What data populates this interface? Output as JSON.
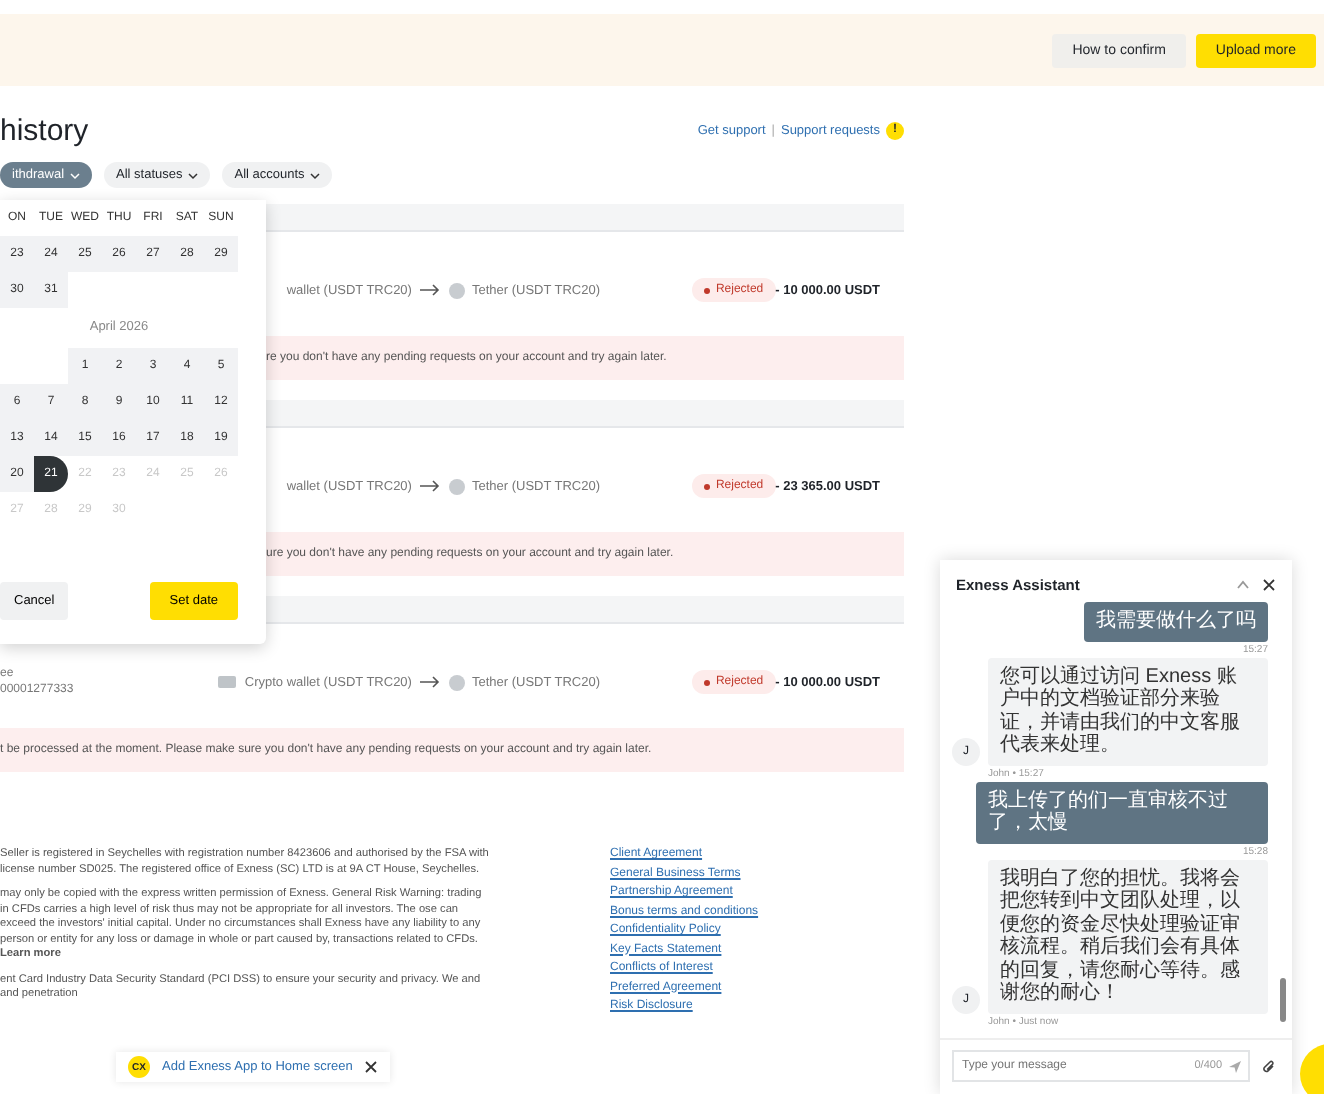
{
  "banner": {
    "buttons": [
      {
        "label": "How to confirm",
        "kind": "secondary"
      },
      {
        "label": "Upload more",
        "kind": "primary"
      }
    ]
  },
  "page": {
    "title": "history",
    "support_link": "Get support",
    "separator": "|",
    "support_requests_link": "Support requests",
    "support_badge": "!"
  },
  "filters": [
    {
      "label": "ithdrawal",
      "selected": true
    },
    {
      "label": "All statuses",
      "selected": false
    },
    {
      "label": "All accounts",
      "selected": false
    }
  ],
  "transactions": [
    {
      "covered_by_picker": true,
      "source": "wallet (USDT TRC20)",
      "target": "Tether (USDT TRC20)",
      "status": "Rejected",
      "amount": "- 10 000.00 USDT",
      "error": "re you don't have any pending requests on your account and try again later."
    },
    {
      "covered_by_picker": true,
      "source": "wallet (USDT TRC20)",
      "target": "Tether (USDT TRC20)",
      "status": "Rejected",
      "amount": "- 23 365.00 USDT",
      "error": "ure you don't have any pending requests on your account and try again later."
    },
    {
      "covered_by_picker": false,
      "info": [
        "ee",
        "00001277333"
      ],
      "source": "Crypto wallet (USDT TRC20)",
      "target": "Tether (USDT TRC20)",
      "status": "Rejected",
      "amount": "- 10 000.00 USDT",
      "error": "t be processed at the moment. Please make sure you don't have any pending requests on your account and try again later."
    }
  ],
  "calendar": {
    "weekdays": [
      "ON",
      "TUE",
      "WED",
      "THU",
      "FRI",
      "SAT",
      "SUN"
    ],
    "months": [
      {
        "weeks": [
          {
            "kind": "start",
            "days": [
              {
                "day": "23",
                "in_range": true,
                "selected": false,
                "disabled": false
              },
              {
                "day": "24",
                "in_range": true,
                "selected": false,
                "disabled": false
              },
              {
                "day": "25",
                "in_range": true,
                "selected": false,
                "disabled": false
              },
              {
                "day": "26",
                "in_range": true,
                "selected": false,
                "disabled": false
              },
              {
                "day": "27",
                "in_range": true,
                "selected": false,
                "disabled": false
              },
              {
                "day": "28",
                "in_range": true,
                "selected": false,
                "disabled": false
              },
              {
                "day": "29",
                "in_range": true,
                "selected": false,
                "disabled": false
              }
            ]
          },
          {
            "kind": "start",
            "days": [
              {
                "day": "30",
                "in_range": true,
                "selected": false,
                "disabled": false
              },
              {
                "day": "31",
                "in_range": true,
                "selected": false,
                "disabled": false
              }
            ]
          }
        ]
      },
      {
        "title": "April 2026",
        "weeks": [
          {
            "kind": "end",
            "days": [
              {
                "day": "1",
                "in_range": true,
                "selected": false,
                "disabled": false
              },
              {
                "day": "2",
                "in_range": true,
                "selected": false,
                "disabled": false
              },
              {
                "day": "3",
                "in_range": true,
                "selected": false,
                "disabled": false
              },
              {
                "day": "4",
                "in_range": true,
                "selected": false,
                "disabled": false
              },
              {
                "day": "5",
                "in_range": true,
                "selected": false,
                "disabled": false
              }
            ]
          },
          {
            "kind": "start",
            "days": [
              {
                "day": "6",
                "in_range": true,
                "selected": false,
                "disabled": false
              },
              {
                "day": "7",
                "in_range": true,
                "selected": false,
                "disabled": false
              },
              {
                "day": "8",
                "in_range": true,
                "selected": false,
                "disabled": false
              },
              {
                "day": "9",
                "in_range": true,
                "selected": false,
                "disabled": false
              },
              {
                "day": "10",
                "in_range": true,
                "selected": false,
                "disabled": false
              },
              {
                "day": "11",
                "in_range": true,
                "selected": false,
                "disabled": false
              },
              {
                "day": "12",
                "in_range": true,
                "selected": false,
                "disabled": false
              }
            ]
          },
          {
            "kind": "start",
            "days": [
              {
                "day": "13",
                "in_range": true,
                "selected": false,
                "disabled": false
              },
              {
                "day": "14",
                "in_range": true,
                "selected": false,
                "disabled": false
              },
              {
                "day": "15",
                "in_range": true,
                "selected": false,
                "disabled": false
              },
              {
                "day": "16",
                "in_range": true,
                "selected": false,
                "disabled": false
              },
              {
                "day": "17",
                "in_range": true,
                "selected": false,
                "disabled": false
              },
              {
                "day": "18",
                "in_range": true,
                "selected": false,
                "disabled": false
              },
              {
                "day": "19",
                "in_range": true,
                "selected": false,
                "disabled": false
              }
            ]
          },
          {
            "kind": "start",
            "days": [
              {
                "day": "20",
                "in_range": true,
                "selected": false,
                "disabled": false
              },
              {
                "day": "21",
                "in_range": false,
                "selected": true,
                "disabled": false
              },
              {
                "day": "22",
                "in_range": false,
                "selected": false,
                "disabled": true
              },
              {
                "day": "23",
                "in_range": false,
                "selected": false,
                "disabled": true
              },
              {
                "day": "24",
                "in_range": false,
                "selected": false,
                "disabled": true
              },
              {
                "day": "25",
                "in_range": false,
                "selected": false,
                "disabled": true
              },
              {
                "day": "26",
                "in_range": false,
                "selected": false,
                "disabled": true
              }
            ]
          },
          {
            "kind": "start",
            "days": [
              {
                "day": "27",
                "in_range": false,
                "selected": false,
                "disabled": true
              },
              {
                "day": "28",
                "in_range": false,
                "selected": false,
                "disabled": true
              },
              {
                "day": "29",
                "in_range": false,
                "selected": false,
                "disabled": true
              },
              {
                "day": "30",
                "in_range": false,
                "selected": false,
                "disabled": true
              }
            ]
          }
        ]
      }
    ],
    "cancel_button": "Cancel",
    "confirm_button": "Set date"
  },
  "footer": {
    "paragraphs": [
      "Seller is registered in Seychelles with registration number 8423606 and authorised by the FSA with license number SD025. The registered office of Exness (SC) LTD is at 9A CT House, Seychelles.",
      "may only be copied with the express written permission of Exness. General Risk Warning: trading in CFDs carries a high level of risk thus may not be appropriate for all investors. The ose can exceed the investors' initial capital. Under no circumstances shall Exness have any liability to any person or entity for any loss or damage in whole or part caused by, transactions related to CFDs. **Learn more**",
      "ent Card Industry Data Security Standard (PCI DSS) to ensure your security and privacy. We and and penetration"
    ],
    "links": [
      "Client Agreement",
      "General Business Terms",
      "Partnership Agreement",
      "Bonus terms and conditions",
      "Confidentiality Policy",
      "Key Facts Statement",
      "Conflicts of Interest",
      "Preferred Agreement",
      "Risk Disclosure"
    ]
  },
  "app_prompt": {
    "logo": "CX",
    "text": "Add Exness App to Home screen"
  },
  "chat": {
    "title": "Exness Assistant",
    "messages": [
      {
        "kind": "user",
        "text": "我需要做什么了吗",
        "time": "15:27"
      },
      {
        "kind": "agent",
        "text": "您可以通过访问 Exness 账户中的文档验证部分来验证，并请由我们的中文客服代表来处理。",
        "time": "John • 15:27",
        "avatar": "J"
      },
      {
        "kind": "user",
        "text": "我上传了的们一直审核不过了，太慢",
        "time": "15:28"
      },
      {
        "kind": "agent",
        "text": "我明白了您的担忧。我将会把您转到中文团队处理，以便您的资金尽快处理验证审核流程。稍后我们会有具体的回复，请您耐心等待。感谢您的耐心！",
        "time": "John • Just now",
        "avatar": "J"
      }
    ],
    "input": {
      "placeholder": "Type your message",
      "counter": "0/400"
    }
  }
}
